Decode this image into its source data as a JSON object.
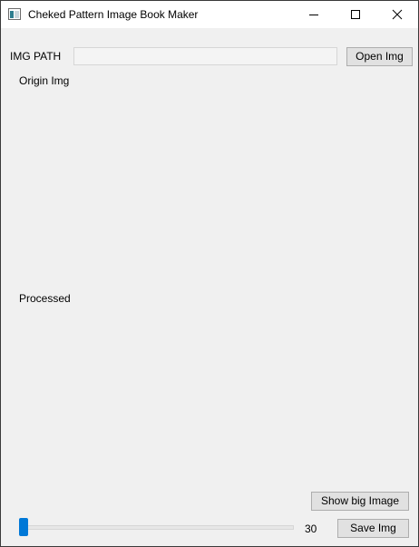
{
  "window": {
    "title": "Cheked Pattern Image Book Maker",
    "controls": [
      "minimize-icon",
      "maximize-icon",
      "close-icon"
    ]
  },
  "path_row": {
    "label": "IMG PATH",
    "value": "",
    "open_button": "Open Img"
  },
  "origin": {
    "label": "Origin Img"
  },
  "processed": {
    "label": "Processed"
  },
  "controls": {
    "show_big_button": "Show big Image",
    "slider_value": "30",
    "save_button": "Save Img"
  },
  "colors": {
    "accent": "#0078d7",
    "window_bg": "#f0f0f0",
    "button_bg": "#e1e1e1"
  }
}
